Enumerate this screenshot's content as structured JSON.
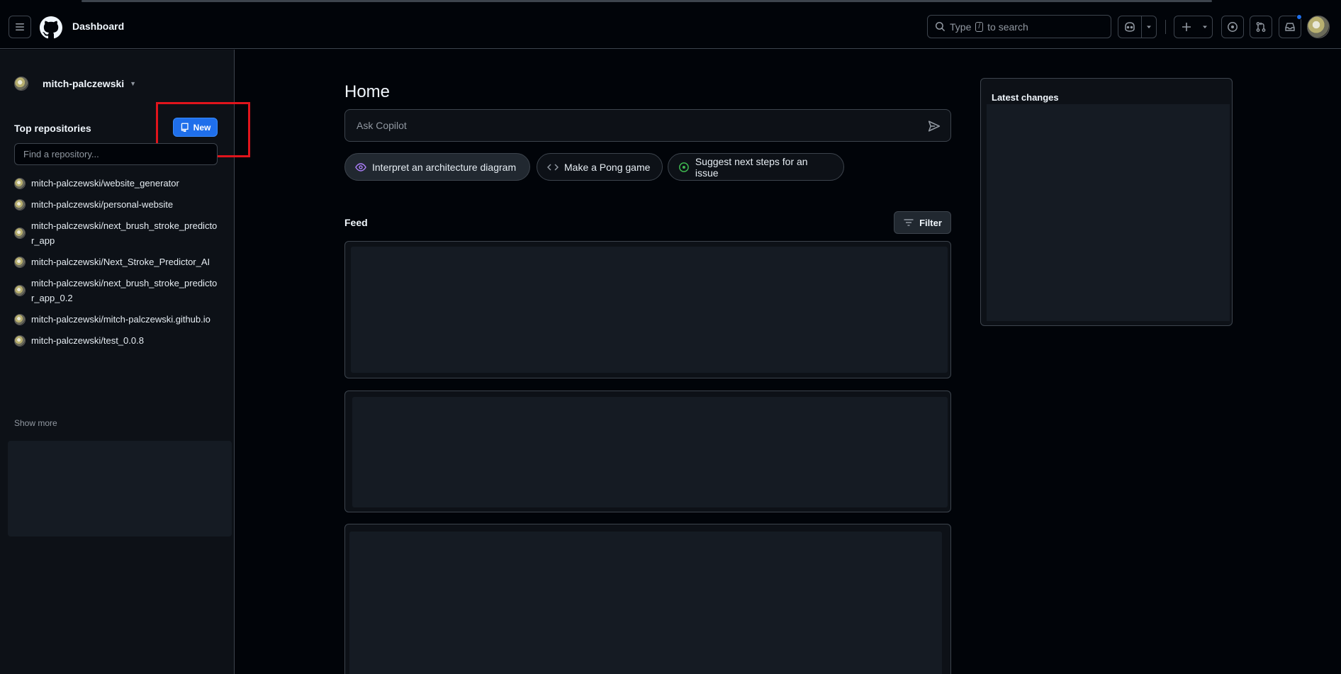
{
  "header": {
    "title": "Dashboard",
    "search_before": "Type",
    "search_key": "/",
    "search_after": "to search"
  },
  "sidebar": {
    "username": "mitch-palczewski",
    "top_repos_label": "Top repositories",
    "new_button_label": "New",
    "find_placeholder": "Find a repository...",
    "repos": [
      "mitch-palczewski/website_generator",
      "mitch-palczewski/personal-website",
      "mitch-palczewski/next_brush_stroke_predictor_app",
      "mitch-palczewski/Next_Stroke_Predictor_AI",
      "mitch-palczewski/next_brush_stroke_predictor_app_0.2",
      "mitch-palczewski/mitch-palczewski.github.io",
      "mitch-palczewski/test_0.0.8"
    ],
    "show_more": "Show more"
  },
  "main": {
    "home_title": "Home",
    "copilot_placeholder": "Ask Copilot",
    "suggestions": [
      "Interpret an architecture diagram",
      "Make a Pong game",
      "Suggest next steps for an issue"
    ],
    "feed_title": "Feed",
    "filter_label": "Filter"
  },
  "latest_changes": {
    "title": "Latest changes"
  },
  "colors": {
    "accent": "#1f6feb",
    "highlight_box": "#e0141c",
    "notification_dot": "#1f6feb"
  }
}
